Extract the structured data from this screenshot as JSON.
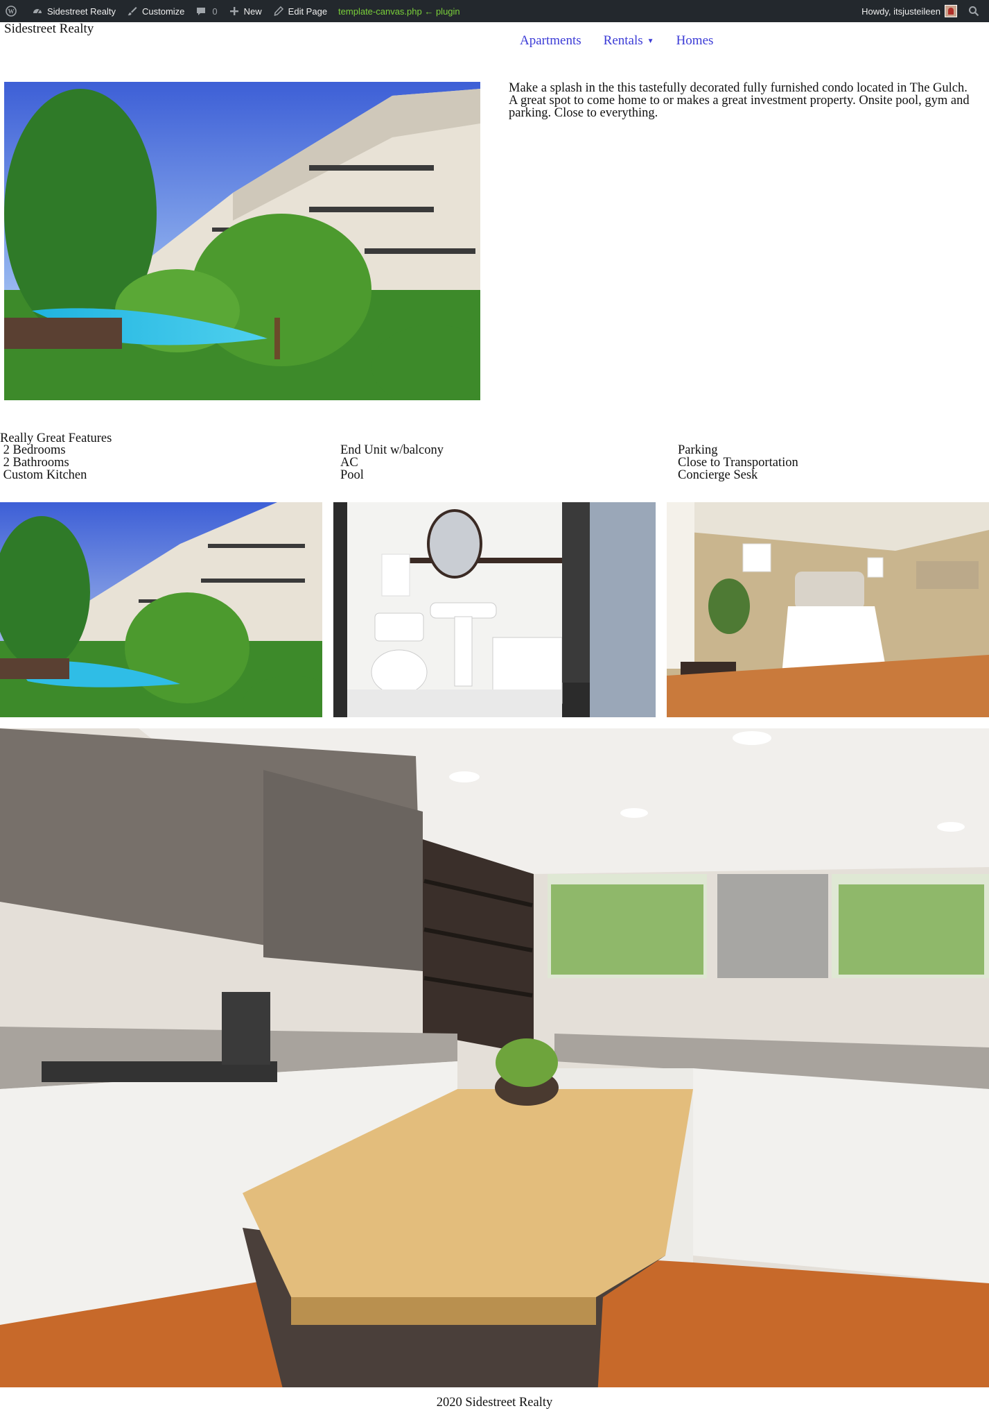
{
  "admin_bar": {
    "site_name": "Sidestreet Realty",
    "customize": "Customize",
    "comments_count": "0",
    "new": "New",
    "edit_page": "Edit Page",
    "template_info": "template-canvas.php ← plugin",
    "howdy": "Howdy, itsjusteileen"
  },
  "site": {
    "title": "Sidestreet Realty"
  },
  "nav": {
    "items": [
      {
        "label": "Apartments"
      },
      {
        "label": "Rentals"
      },
      {
        "label": "Homes"
      }
    ]
  },
  "hero": {
    "description": "Make a splash in the this tastefully decorated fully furnished condo located in The Gulch. A great spot to come home to or makes a great investment property. Onsite pool, gym and parking. Close to everything."
  },
  "features": {
    "title": "Really Great Features",
    "col1": [
      " 2 Bedrooms",
      " 2 Bathrooms",
      " Custom Kitchen"
    ],
    "col2": [
      "End Unit w/balcony",
      "AC",
      "Pool"
    ],
    "col3": [
      "Parking",
      "Close to Transportation",
      "Concierge Sesk"
    ]
  },
  "footer": {
    "text": "2020 Sidestreet Realty"
  },
  "colors": {
    "admin_bar": "#23282d",
    "nav_link": "#3b3bd6",
    "admin_green": "#7ad03a"
  }
}
